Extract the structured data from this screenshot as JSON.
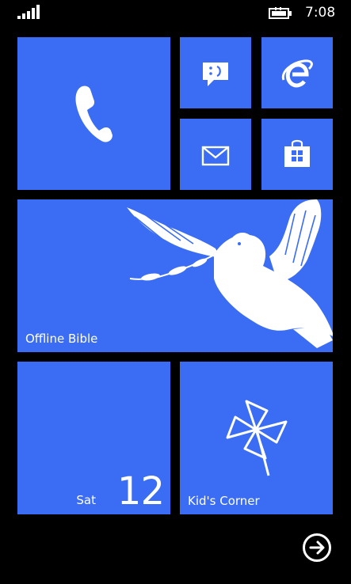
{
  "status_bar": {
    "time": "7:08",
    "icons": [
      "signal-strength-icon",
      "battery-charging-icon"
    ]
  },
  "tiles": {
    "phone": {
      "icon": "phone-icon"
    },
    "messaging": {
      "icon": "messaging-icon"
    },
    "internet_explorer": {
      "icon": "internet-explorer-icon"
    },
    "email": {
      "icon": "mail-icon"
    },
    "store": {
      "icon": "store-icon"
    },
    "offline_bible": {
      "label": "Offline Bible",
      "icon": "dove-icon"
    },
    "calendar": {
      "day": "Sat",
      "date": "12"
    },
    "kids_corner": {
      "label": "Kid's Corner",
      "icon": "pinwheel-icon"
    }
  },
  "navigation": {
    "next_icon": "arrow-right-circle-icon"
  },
  "colors": {
    "tile": "#3a6cf4",
    "background": "#000000",
    "text": "#ffffff"
  }
}
